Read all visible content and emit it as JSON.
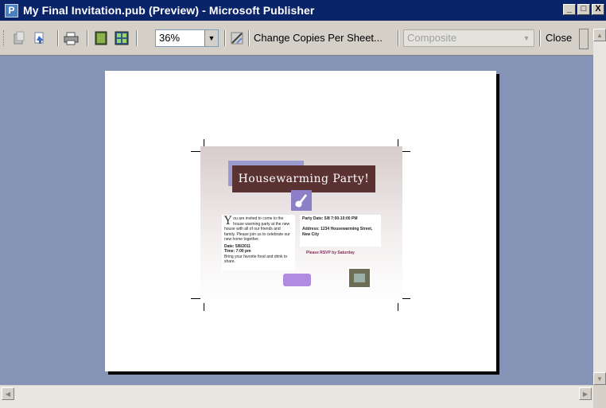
{
  "window": {
    "title": "My Final Invitation.pub (Preview)  - Microsoft Publisher",
    "app_icon": "publisher-icon",
    "buttons": {
      "minimize": "_",
      "maximize": "□",
      "close": "X"
    }
  },
  "toolbar": {
    "zoom_value": "36%",
    "change_copies_label": "Change Copies Per Sheet...",
    "color_mode_value": "Composite",
    "close_label": "Close",
    "icons": [
      "page-up-icon",
      "page-down-icon",
      "print-icon",
      "one-page-icon",
      "multiple-pages-icon",
      "color-toggle-icon"
    ]
  },
  "invitation": {
    "heading": "Housewarming Party!",
    "dropcap": "Y",
    "body_left": "ou are invited to come to the house warming party at the new house with all of our friends and family. Please join us to celebrate our new home together.",
    "left_line2": "Date: 5/8/2011",
    "left_line3": "Time: 7:00 pm",
    "left_line4": "Bring your favorite food and drink to share.",
    "right_line1": "Party Date: 5/8 7:00-10:00 PM",
    "right_line2": "Address: 1234 Housewarming Street, New City",
    "rsvp": "Please RSVP by Saturday"
  }
}
